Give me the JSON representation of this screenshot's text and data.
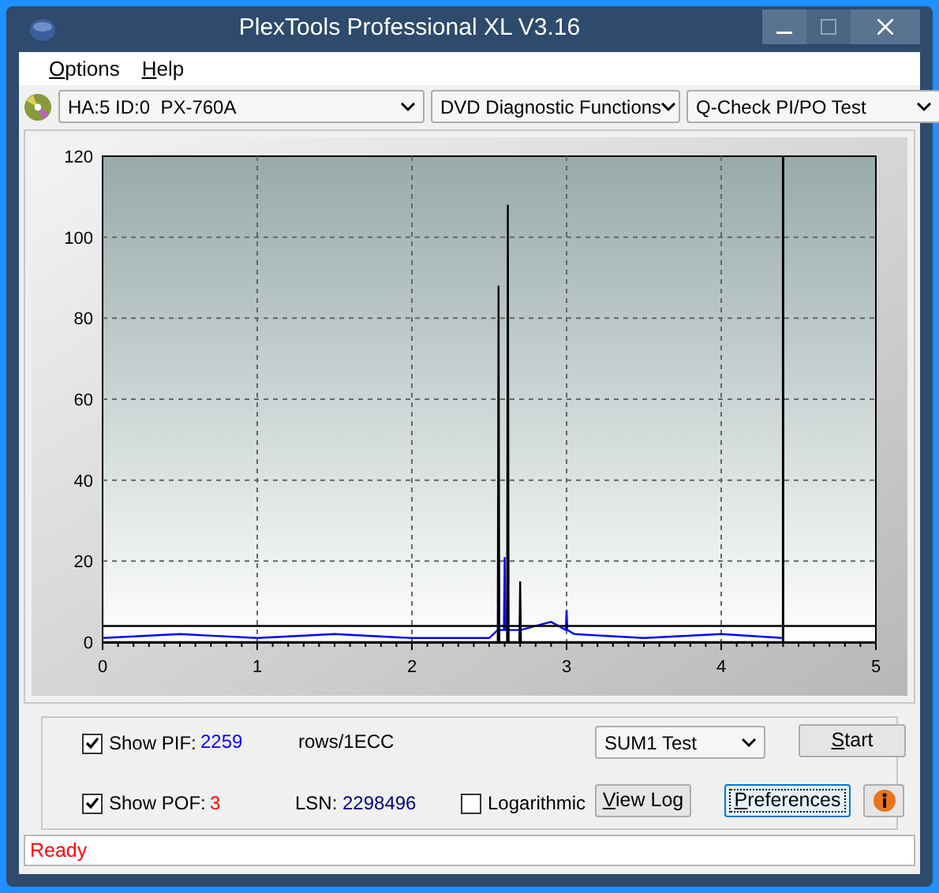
{
  "window": {
    "title": "PlexTools Professional XL V3.16"
  },
  "menu": [
    {
      "label": "Options"
    },
    {
      "label": "Help"
    }
  ],
  "toolbar": {
    "drive": "HA:5 ID:0  PX-760A",
    "function": "DVD Diagnostic Functions",
    "test": "Q-Check PI/PO Test"
  },
  "chart": {
    "chart_data": {
      "type": "line",
      "x": [
        0,
        0.5,
        1,
        1.5,
        2,
        2.5,
        2.555,
        2.56,
        2.565,
        2.595,
        2.6,
        2.605,
        2.615,
        2.62,
        2.625,
        2.695,
        2.7,
        2.705,
        2.8,
        2.9,
        2.995,
        3,
        3.005,
        3.05,
        3.5,
        4,
        4.4
      ],
      "series": [
        {
          "color": "#0000ff",
          "values": [
            1,
            2,
            1,
            2,
            1,
            1,
            3,
            3,
            3,
            3,
            21,
            3,
            3,
            4,
            3,
            3,
            3,
            3,
            4,
            5,
            3,
            8,
            3,
            2,
            1,
            2,
            1
          ]
        },
        {
          "color": "#000000",
          "values": [
            0,
            0,
            0,
            0,
            0,
            0,
            0,
            88,
            0,
            0,
            0,
            0,
            0,
            108,
            0,
            0,
            15,
            0,
            0,
            0,
            0,
            0,
            0,
            0,
            0,
            0,
            0
          ]
        }
      ],
      "xlim": [
        0,
        5
      ],
      "ylim": [
        0,
        120
      ],
      "xticks": [
        0,
        1,
        2,
        3,
        4,
        5
      ],
      "yticks": [
        0,
        20,
        40,
        60,
        80,
        100,
        120
      ],
      "grid": true,
      "ref_lines": [
        {
          "axis": "y",
          "value": 4
        },
        {
          "axis": "x",
          "value": 4.4
        }
      ]
    }
  },
  "controls": {
    "show_pif": {
      "label": "Show PIF:",
      "checked": true,
      "value": "2259",
      "unit": "rows/1ECC"
    },
    "show_pof": {
      "label": "Show POF:",
      "checked": true,
      "value": "3"
    },
    "lsn": {
      "label": "LSN:",
      "value": "2298496"
    },
    "logarithmic": {
      "label": "Logarithmic",
      "checked": false
    },
    "test_select": "SUM1 Test",
    "buttons": [
      {
        "label": "Start",
        "kind": "start"
      },
      {
        "label": "View Log",
        "kind": "log"
      },
      {
        "label": "Preferences",
        "kind": "prefs",
        "focused": true
      }
    ]
  },
  "status_bar": "Ready"
}
